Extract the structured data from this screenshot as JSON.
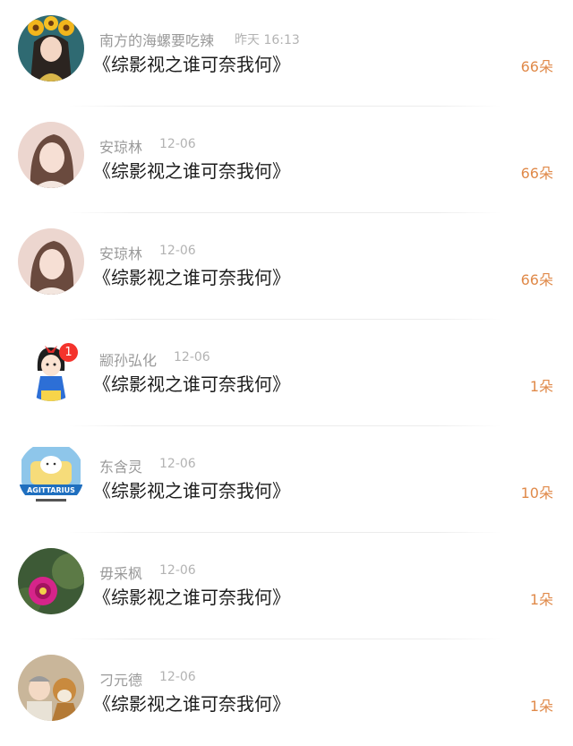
{
  "rows": [
    {
      "name": "南方的海螺要吃辣",
      "time": "昨天 16:13",
      "title": "《综影视之谁可奈我何》",
      "flowers": "66朵",
      "avatar": "girl-sunflower-avatar"
    },
    {
      "name": "安琼林",
      "time": "12-06",
      "title": "《综影视之谁可奈我何》",
      "flowers": "66朵",
      "avatar": "woman-portrait-avatar"
    },
    {
      "name": "安琼林",
      "time": "12-06",
      "title": "《综影视之谁可奈我何》",
      "flowers": "66朵",
      "avatar": "woman-portrait-avatar"
    },
    {
      "name": "颛孙弘化",
      "time": "12-06",
      "title": "《综影视之谁可奈我何》",
      "flowers": "1朵",
      "avatar": "snow-white-cartoon-avatar",
      "badge": "1"
    },
    {
      "name": "东含灵",
      "time": "12-06",
      "title": "《综影视之谁可奈我何》",
      "flowers": "10朵",
      "avatar": "sagittarius-sticker-avatar",
      "avatar_text": "AGITTARIUS"
    },
    {
      "name": "毋采枫",
      "time": "12-06",
      "title": "《综影视之谁可奈我何》",
      "flowers": "1朵",
      "avatar": "cactus-flower-avatar"
    },
    {
      "name": "刁元德",
      "time": "12-06",
      "title": "《综影视之谁可奈我何》",
      "flowers": "1朵",
      "avatar": "baby-and-dog-avatar"
    }
  ],
  "colors": {
    "flowers": "#e08a4a",
    "name": "#9a9a9a",
    "time": "#b3b3b3",
    "title": "#1c1c1c",
    "badge": "#f4332c"
  }
}
